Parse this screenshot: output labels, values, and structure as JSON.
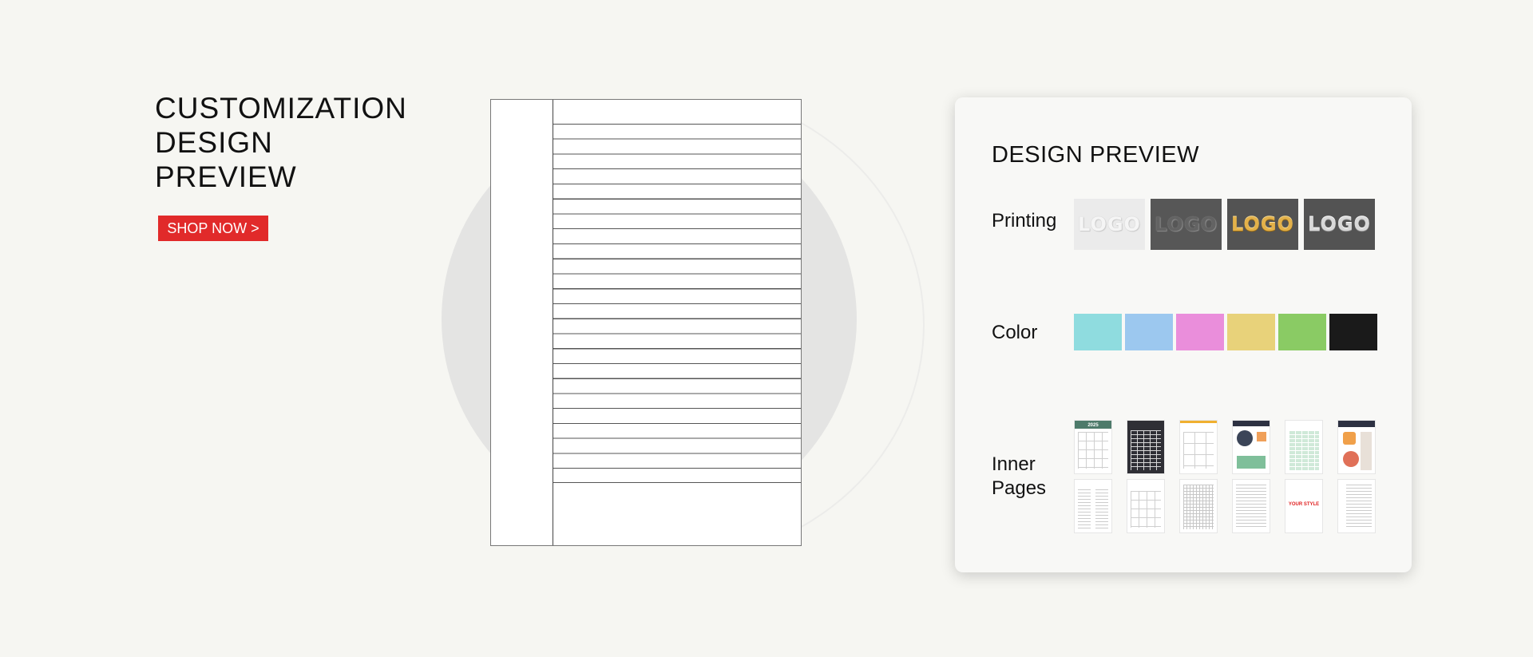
{
  "hero": {
    "title_lines": [
      "CUSTOMIZATION",
      "DESIGN",
      "PREVIEW"
    ],
    "cta_label": "SHOP NOW >"
  },
  "card": {
    "title": "DESIGN PREVIEW",
    "printing": {
      "label": "Printing",
      "tiles": [
        {
          "text": "LOGO",
          "style": "white-emboss"
        },
        {
          "text": "LOGO",
          "style": "dark-deboss"
        },
        {
          "text": "LOGO",
          "style": "gold-foil"
        },
        {
          "text": "LOGO",
          "style": "silver-foil"
        }
      ]
    },
    "color": {
      "label": "Color",
      "swatches": [
        "#8fdcdf",
        "#9cc8ef",
        "#ea8edb",
        "#e8d27a",
        "#8acb64",
        "#1a1a1a"
      ]
    },
    "inner_pages": {
      "label_lines": [
        "Inner",
        "Pages"
      ],
      "thumbnails": [
        {
          "kind": "yearly-calendar",
          "text": "2025"
        },
        {
          "kind": "dark-table"
        },
        {
          "kind": "habit-boxes"
        },
        {
          "kind": "colorful-planner"
        },
        {
          "kind": "green-table"
        },
        {
          "kind": "dark-header-planner"
        },
        {
          "kind": "weekly-list"
        },
        {
          "kind": "monthly-calendar"
        },
        {
          "kind": "grid"
        },
        {
          "kind": "lined"
        },
        {
          "kind": "custom-style",
          "text": "YOUR STYLE"
        },
        {
          "kind": "lined-2"
        }
      ]
    }
  }
}
